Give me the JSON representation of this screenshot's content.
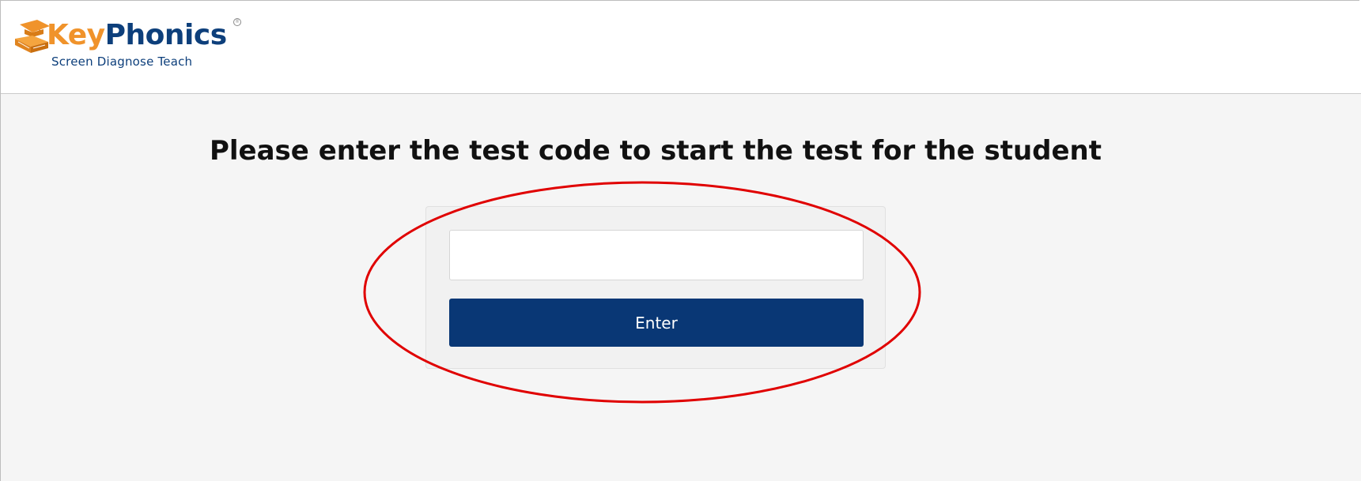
{
  "header": {
    "logo": {
      "brand_first": "Key",
      "brand_second": "Phonics",
      "registered_mark": "®",
      "tagline": "Screen Diagnose Teach",
      "colors": {
        "key": "#f0932b",
        "phonics": "#0d3f7b"
      }
    }
  },
  "main": {
    "heading": "Please enter the test code to start the test for the student",
    "test_code_input": {
      "value": "",
      "placeholder": ""
    },
    "enter_button_label": "Enter",
    "colors": {
      "button": "#093775",
      "background": "#f5f5f5",
      "highlight": "#e00000"
    }
  }
}
